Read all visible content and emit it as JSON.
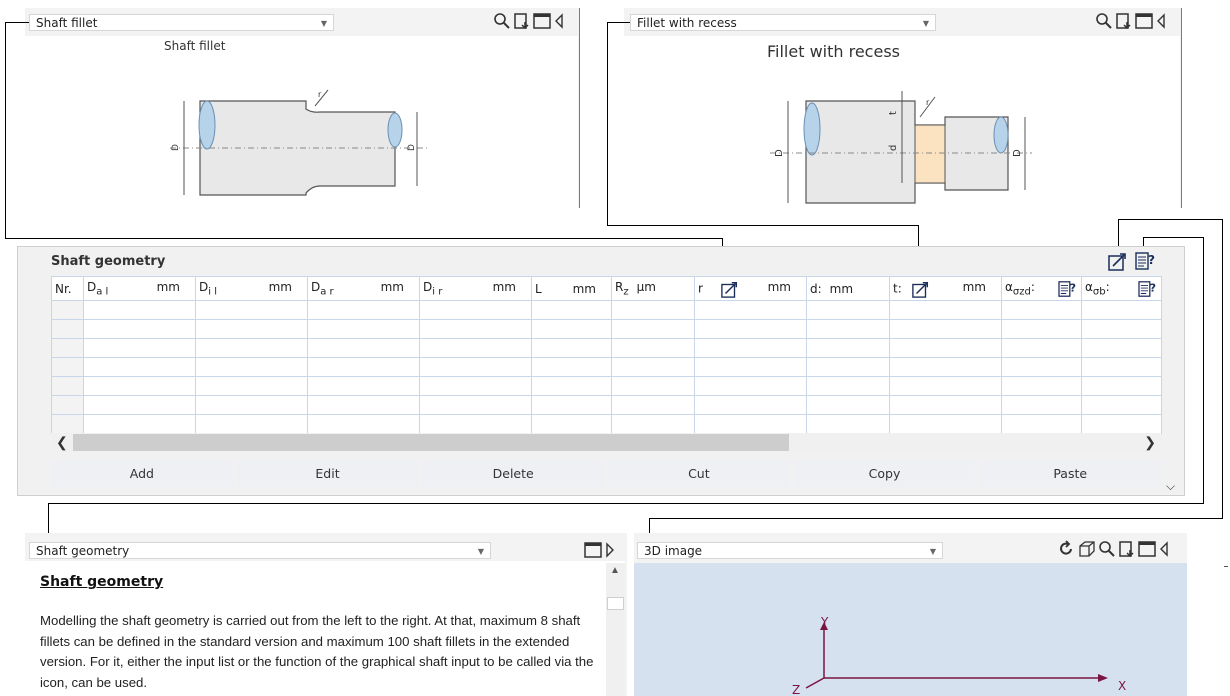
{
  "top_left_panel": {
    "dropdown_value": "Shaft fillet",
    "image_title": "Shaft fillet"
  },
  "top_right_panel": {
    "dropdown_value": "Fillet with recess",
    "image_title": "Fillet with recess"
  },
  "shaft_table": {
    "title": "Shaft geometry",
    "columns": [
      {
        "label": "Nr.",
        "unit": ""
      },
      {
        "label": "D",
        "sub": "a l",
        "unit": "mm"
      },
      {
        "label": "D",
        "sub": "i l",
        "unit": "mm"
      },
      {
        "label": "D",
        "sub": "a r",
        "unit": "mm"
      },
      {
        "label": "D",
        "sub": "i r",
        "unit": "mm"
      },
      {
        "label": "L",
        "unit": "mm"
      },
      {
        "label": "R",
        "sub": "z",
        "unit": "µm"
      },
      {
        "label": "r",
        "unit": "mm"
      },
      {
        "label": "d:",
        "unit": "mm"
      },
      {
        "label": "t:",
        "unit": "mm"
      },
      {
        "label": "α",
        "sub": "σzd",
        "suffix": ":"
      },
      {
        "label": "α",
        "sub": "σb",
        "suffix": ":"
      }
    ],
    "buttons": {
      "add": "Add",
      "edit": "Edit",
      "delete": "Delete",
      "cut": "Cut",
      "copy": "Copy",
      "paste": "Paste"
    }
  },
  "bottom_left_panel": {
    "dropdown_value": "Shaft geometry",
    "help_title": "Shaft geometry",
    "help_text": "Modelling the shaft geometry is carried out from the left to the right. At that, maximum 8 shaft fillets can be defined in the standard version and maximum 100 shaft fillets in the extended version. For it, either the input list or the function of the graphical shaft input to be called via the icon, can be used."
  },
  "bottom_right_panel": {
    "dropdown_value": "3D image",
    "axis_x": "X",
    "axis_y": "Y",
    "axis_z": "Z"
  },
  "drawing_labels": {
    "left_D": "D",
    "left_D1": "D",
    "left_r": "r",
    "right_D": "D",
    "right_D1": "D",
    "right_d": "d",
    "right_t": "t",
    "right_r": "r"
  },
  "colors": {
    "panel_border": "#5a7fb5",
    "grid_line": "#c8d6ea",
    "viewport_bg": "#d6e1ef",
    "axis_color": "#7a1440",
    "recess_fill": "#fbe3c2"
  }
}
